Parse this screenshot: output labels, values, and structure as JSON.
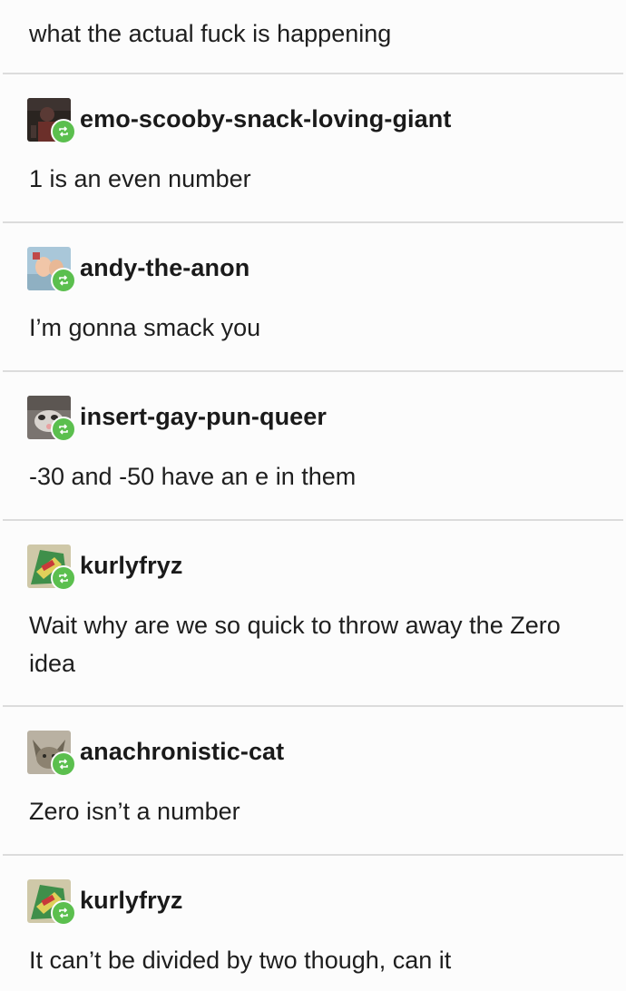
{
  "thread": {
    "top_text": "what the actual fuck is happening",
    "posts": [
      {
        "username": "emo-scooby-snack-loving-giant",
        "avatar_icon": "dark-figure-avatar-icon",
        "text": "1 is an even number"
      },
      {
        "username": "andy-the-anon",
        "avatar_icon": "cartoon-hands-avatar-icon",
        "text": "I’m gonna smack you"
      },
      {
        "username": "insert-gay-pun-queer",
        "avatar_icon": "opossum-avatar-icon",
        "text": "-30 and -50 have an e in them"
      },
      {
        "username": "kurlyfryz",
        "avatar_icon": "snack-bag-avatar-icon",
        "text": "Wait why are we so quick to throw away the Zero idea"
      },
      {
        "username": "anachronistic-cat",
        "avatar_icon": "cat-avatar-icon",
        "text": "Zero isn’t a number"
      },
      {
        "username": "kurlyfryz",
        "avatar_icon": "snack-bag-avatar-icon",
        "text": "It can’t be divided by two though, can it"
      }
    ]
  },
  "colors": {
    "reblog_badge": "#5bbf4e",
    "divider": "#dcdcdc",
    "background": "#fcfcfc",
    "text": "#1e1e1e"
  }
}
